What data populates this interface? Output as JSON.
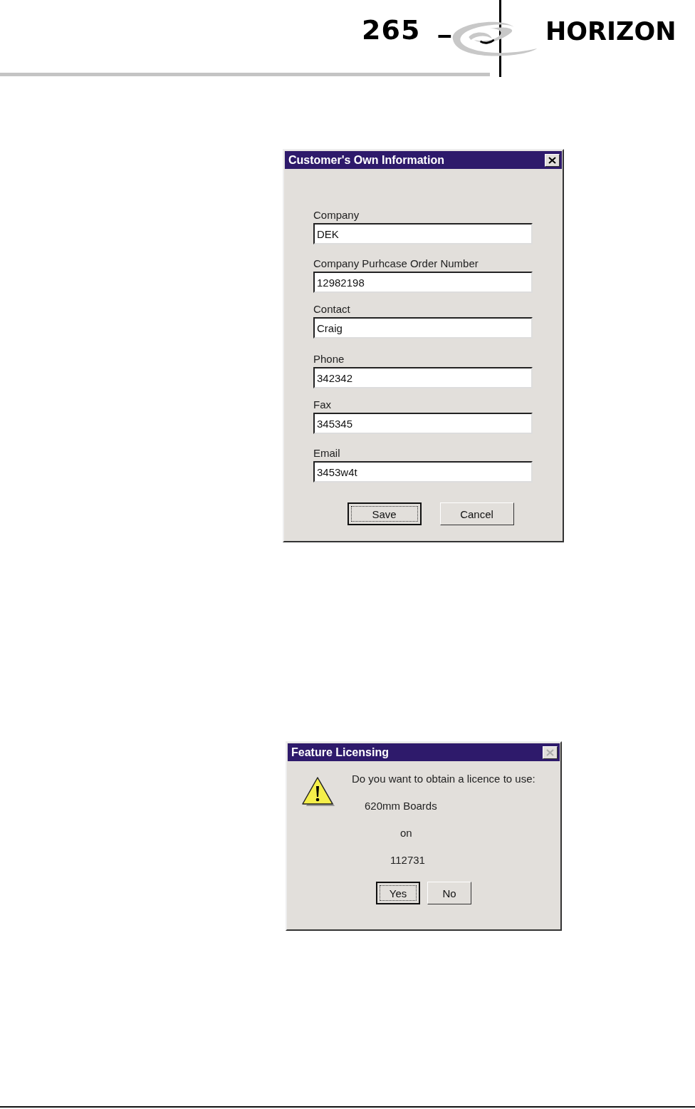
{
  "header": {
    "page_number": "265",
    "brand": "HORIZON"
  },
  "dialogs": [
    {
      "kind": "form",
      "title": "Customer's Own Information",
      "close_disabled": false,
      "fields": [
        {
          "label": "Company",
          "value": "DEK"
        },
        {
          "label": "Company Purhcase Order Number",
          "value": "12982198"
        },
        {
          "label": "Contact",
          "value": "Craig"
        },
        {
          "label": "Phone",
          "value": "342342"
        },
        {
          "label": "Fax",
          "value": "345345"
        },
        {
          "label": "Email",
          "value": "3453w4t"
        }
      ],
      "buttons": [
        {
          "label": "Save",
          "default": true
        },
        {
          "label": "Cancel",
          "default": false
        }
      ]
    },
    {
      "kind": "message",
      "title": "Feature Licensing",
      "close_disabled": true,
      "lines": [
        "Do you want to obtain a licence to use:",
        "620mm Boards",
        "on",
        "112731"
      ],
      "buttons": [
        {
          "label": "Yes",
          "default": true
        },
        {
          "label": "No",
          "default": false
        }
      ]
    }
  ]
}
